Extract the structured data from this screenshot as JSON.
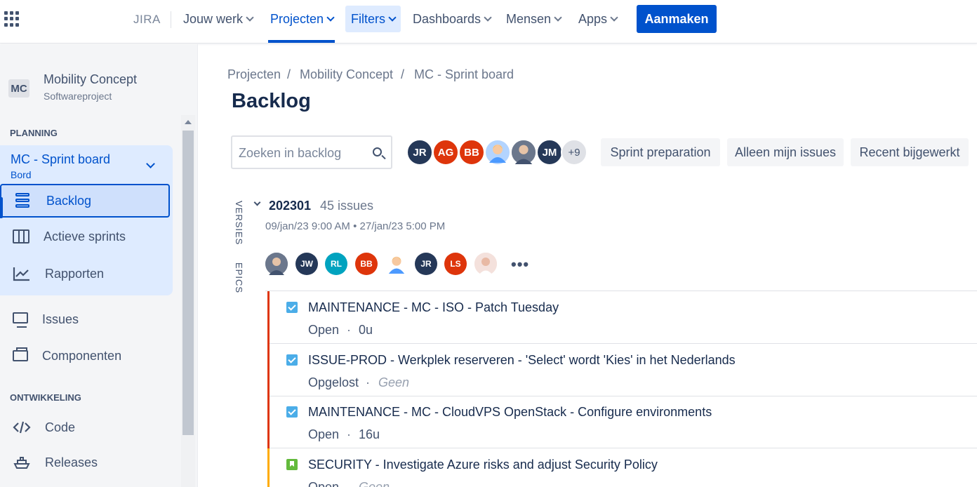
{
  "topnav": {
    "logo": "JIRA",
    "items": [
      {
        "label": "Jouw werk"
      },
      {
        "label": "Projecten"
      },
      {
        "label": "Filters"
      },
      {
        "label": "Dashboards"
      },
      {
        "label": "Mensen"
      },
      {
        "label": "Apps"
      }
    ],
    "create_label": "Aanmaken"
  },
  "sidebar": {
    "project_initials": "MC",
    "project_name": "Mobility Concept",
    "project_type": "Softwareproject",
    "planning_title": "PLANNING",
    "board_name": "MC - Sprint board",
    "board_sub": "Bord",
    "planning_items": [
      {
        "label": "Backlog"
      },
      {
        "label": "Actieve sprints"
      },
      {
        "label": "Rapporten"
      }
    ],
    "other_items": [
      {
        "label": "Issues"
      },
      {
        "label": "Componenten"
      }
    ],
    "dev_title": "ONTWIKKELING",
    "dev_items": [
      {
        "label": "Code"
      },
      {
        "label": "Releases"
      }
    ]
  },
  "breadcrumb": {
    "items": [
      "Projecten",
      "Mobility Concept",
      "MC - Sprint board"
    ],
    "separator": "/"
  },
  "page": {
    "title": "Backlog",
    "search_placeholder": "Zoeken in backlog"
  },
  "avatars": [
    {
      "initials": "JR",
      "color": "#253858"
    },
    {
      "initials": "AG",
      "color": "#de350b"
    },
    {
      "initials": "BB",
      "color": "#de350b"
    },
    {
      "initials": "",
      "color": "#b3d4ff"
    },
    {
      "initials": "",
      "color": "#8993a4"
    },
    {
      "initials": "JM",
      "color": "#253858"
    },
    {
      "initials": "+9",
      "color": "#dfe1e6"
    }
  ],
  "filters": [
    "Sprint preparation",
    "Alleen mijn issues",
    "Recent bijgewerkt"
  ],
  "side_labels": {
    "versions": "VERSIES",
    "epics": "EPICS"
  },
  "sprint": {
    "name": "202301",
    "count": "45 issues",
    "dates": "09/jan/23 9:00 AM • 27/jan/23 5:00 PM",
    "members": [
      {
        "initials": "",
        "color": "#8993a4"
      },
      {
        "initials": "JW",
        "color": "#253858"
      },
      {
        "initials": "RL",
        "color": "#00a3bf"
      },
      {
        "initials": "BB",
        "color": "#de350b"
      },
      {
        "initials": "",
        "color": "#b3d4ff"
      },
      {
        "initials": "JR",
        "color": "#253858"
      },
      {
        "initials": "LS",
        "color": "#de350b"
      },
      {
        "initials": "",
        "color": "#f4e1dc"
      }
    ],
    "more": "•••"
  },
  "issues": [
    {
      "type": "task",
      "summary": "MAINTENANCE - MC - ISO - Patch Tuesday",
      "status": "Open",
      "sep": "·",
      "estimate": "0u",
      "color": "#de350b"
    },
    {
      "type": "task",
      "summary": "ISSUE-PROD - Werkplek reserveren - 'Select' wordt 'Kies' in het Nederlands",
      "status": "Opgelost",
      "sep": "·",
      "estimate": "Geen",
      "color": "#de350b"
    },
    {
      "type": "task",
      "summary": "MAINTENANCE - MC - CloudVPS OpenStack - Configure environments",
      "status": "Open",
      "sep": "·",
      "estimate": "16u",
      "color": "#de350b"
    },
    {
      "type": "story",
      "summary": "SECURITY - Investigate Azure risks and adjust Security Policy",
      "status": "Open",
      "sep": "·",
      "estimate": "Geen",
      "color": "#ffab00"
    }
  ]
}
